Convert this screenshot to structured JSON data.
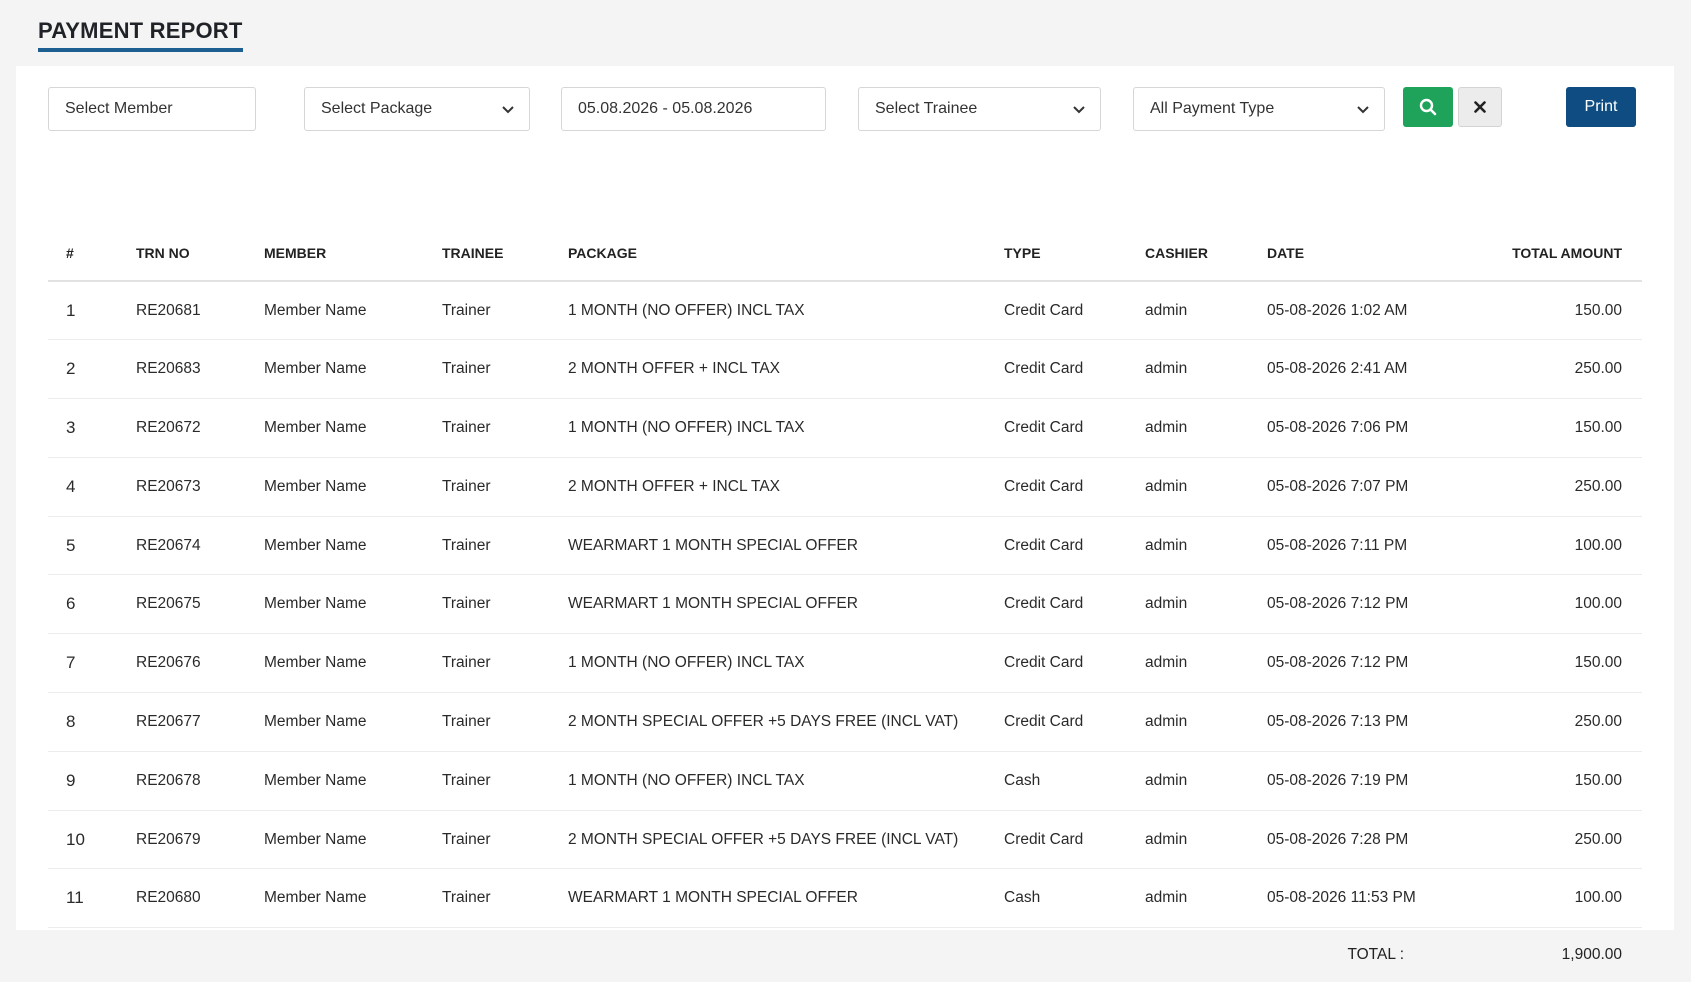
{
  "page": {
    "title": "PAYMENT REPORT"
  },
  "filters": {
    "member_placeholder": "Select Member",
    "package_label": "Select Package",
    "date_range": "05.08.2026 - 05.08.2026",
    "trainee_label": "Select Trainee",
    "payment_type_label": "All Payment Type",
    "print_label": "Print"
  },
  "colors": {
    "accent": "#1d5f91",
    "search": "#1fa35a",
    "print": "#0f4c81"
  },
  "table": {
    "headers": [
      "#",
      "TRN NO",
      "MEMBER",
      "TRAINEE",
      "PACKAGE",
      "TYPE",
      "CASHIER",
      "DATE",
      "TOTAL AMOUNT"
    ],
    "rows": [
      [
        "1",
        "RE20681",
        "Member Name",
        "Trainer",
        "1 MONTH (NO OFFER) INCL TAX",
        "Credit Card",
        "admin",
        "05-08-2026 1:02 AM",
        "150.00"
      ],
      [
        "2",
        "RE20683",
        "Member Name",
        "Trainer",
        "2 MONTH OFFER + INCL TAX",
        "Credit Card",
        "admin",
        "05-08-2026 2:41 AM",
        "250.00"
      ],
      [
        "3",
        "RE20672",
        "Member Name",
        "Trainer",
        "1 MONTH (NO OFFER) INCL TAX",
        "Credit Card",
        "admin",
        "05-08-2026 7:06 PM",
        "150.00"
      ],
      [
        "4",
        "RE20673",
        "Member Name",
        "Trainer",
        "2 MONTH OFFER + INCL TAX",
        "Credit Card",
        "admin",
        "05-08-2026 7:07 PM",
        "250.00"
      ],
      [
        "5",
        "RE20674",
        "Member Name",
        "Trainer",
        "WEARMART 1 MONTH SPECIAL OFFER",
        "Credit Card",
        "admin",
        "05-08-2026 7:11 PM",
        "100.00"
      ],
      [
        "6",
        "RE20675",
        "Member Name",
        "Trainer",
        "WEARMART 1 MONTH SPECIAL OFFER",
        "Credit Card",
        "admin",
        "05-08-2026 7:12 PM",
        "100.00"
      ],
      [
        "7",
        "RE20676",
        "Member Name",
        "Trainer",
        "1 MONTH (NO OFFER) INCL TAX",
        "Credit Card",
        "admin",
        "05-08-2026 7:12 PM",
        "150.00"
      ],
      [
        "8",
        "RE20677",
        "Member Name",
        "Trainer",
        "2 MONTH SPECIAL OFFER +5 DAYS FREE (INCL VAT)",
        "Credit Card",
        "admin",
        "05-08-2026 7:13 PM",
        "250.00"
      ],
      [
        "9",
        "RE20678",
        "Member Name",
        "Trainer",
        "1 MONTH (NO OFFER) INCL TAX",
        "Cash",
        "admin",
        "05-08-2026 7:19 PM",
        "150.00"
      ],
      [
        "10",
        "RE20679",
        "Member Name",
        "Trainer",
        "2 MONTH SPECIAL OFFER +5 DAYS FREE (INCL VAT)",
        "Credit Card",
        "admin",
        "05-08-2026 7:28 PM",
        "250.00"
      ],
      [
        "11",
        "RE20680",
        "Member Name",
        "Trainer",
        "WEARMART 1 MONTH SPECIAL OFFER",
        "Cash",
        "admin",
        "05-08-2026 11:53 PM",
        "100.00"
      ]
    ],
    "total_label": "TOTAL :",
    "total_value": "1,900.00"
  }
}
